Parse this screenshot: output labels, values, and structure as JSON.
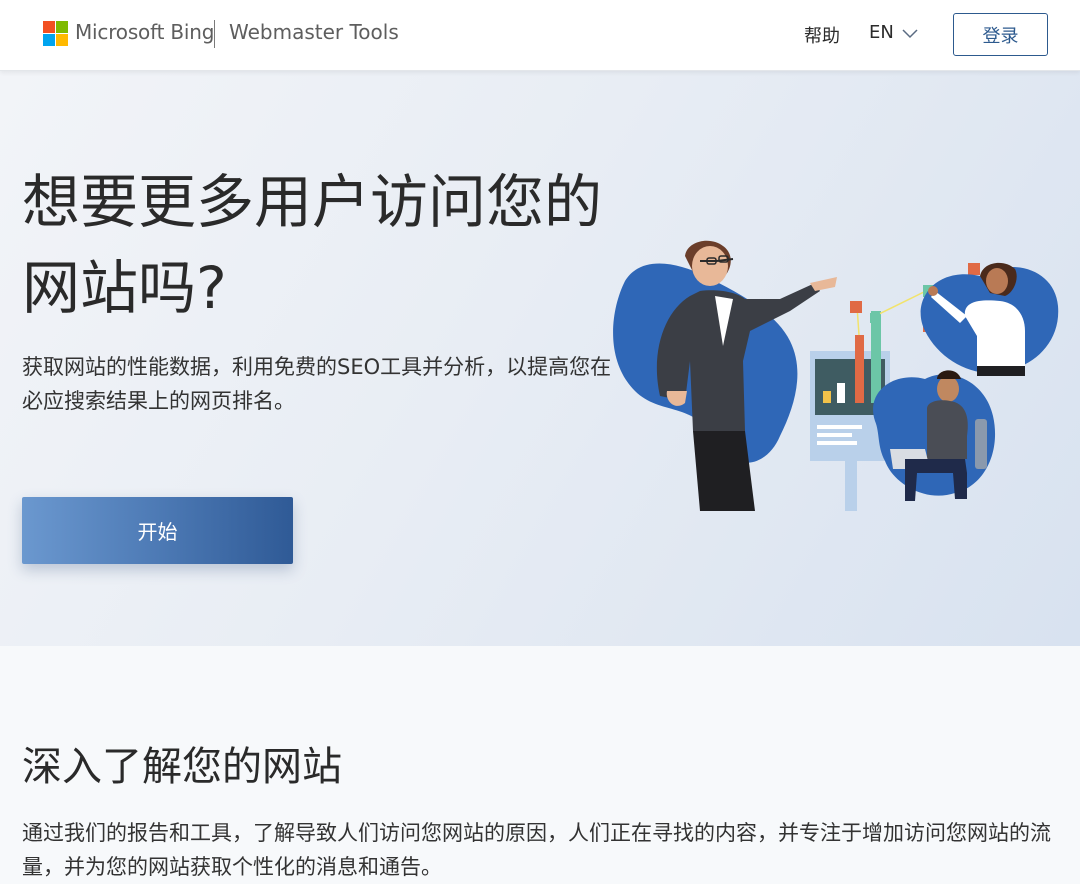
{
  "header": {
    "brand_name": "Microsoft Bing",
    "product_name": "Webmaster Tools",
    "help_label": "帮助",
    "language_label": "EN",
    "login_label": "登录",
    "logo_colors": [
      "#f25022",
      "#7fba00",
      "#00a4ef",
      "#ffb900"
    ]
  },
  "hero": {
    "title": "想要更多用户访问您的网站吗?",
    "subtitle": "获取网站的性能数据，利用免费的SEO工具并分析，以提高您在必应搜索结果上的网页排名。",
    "cta_label": "开始",
    "illustration_icon": "webmaster-team-illustration"
  },
  "insights": {
    "title": "深入了解您的网站",
    "text": "通过我们的报告和工具，了解导致人们访问您网站的原因，人们正在寻找的内容，并专注于增加访问您网站的流量，并为您的网站获取个性化的消息和通告。"
  },
  "colors": {
    "accent": "#2d5a8e",
    "button_gradient_start": "#6b98cf",
    "button_gradient_end": "#2f5a96"
  }
}
